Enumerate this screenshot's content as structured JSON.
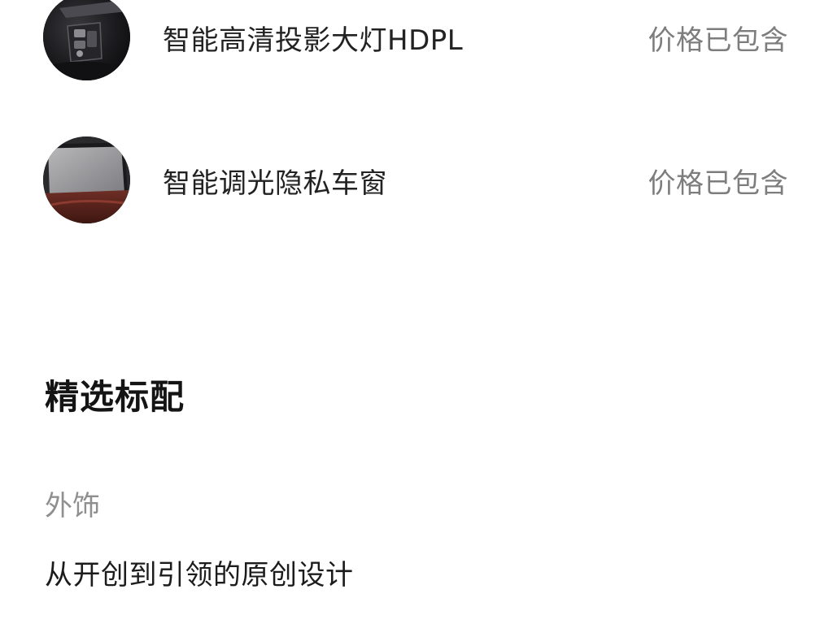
{
  "options": [
    {
      "name": "智能高清投影大灯HDPL",
      "price": "价格已包含",
      "icon": "headlight-thumbnail"
    },
    {
      "name": "智能调光隐私车窗",
      "price": "价格已包含",
      "icon": "window-thumbnail"
    }
  ],
  "section": {
    "title": "精选标配",
    "category": "外饰",
    "item": "从开创到引领的原创设计"
  },
  "colors": {
    "text_primary": "#222222",
    "text_secondary": "#7d7d7d",
    "background": "#ffffff"
  }
}
